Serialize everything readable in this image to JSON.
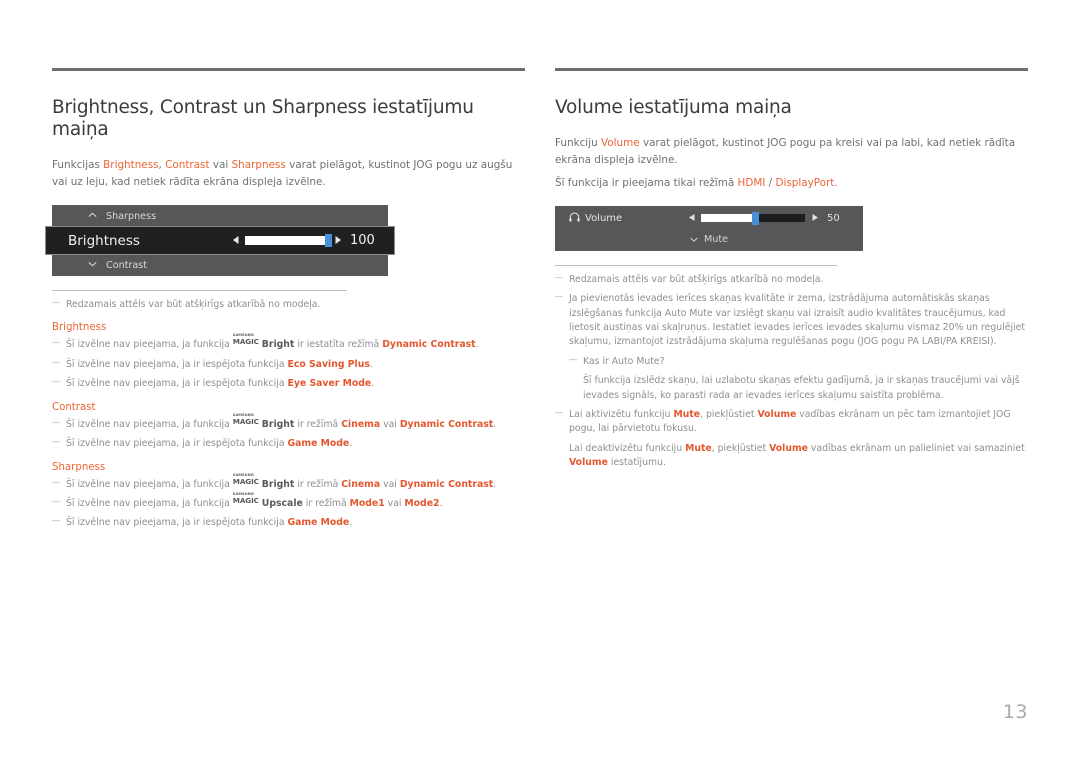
{
  "page": {
    "number": "13",
    "language": "lv"
  },
  "left": {
    "title": "Brightness, Contrast un Sharpness iestatījumu maiņa",
    "intro": {
      "pre": "Funkcijas ",
      "t1": "Brightness",
      "sep1": ", ",
      "t2": "Contrast",
      "sep2": " vai ",
      "t3": "Sharpness",
      "post": " varat pielāgot, kustinot JOG pogu uz augšu vai uz leju, kad netiek rādīta ekrāna displeja izvēlne."
    },
    "osd": {
      "top_label": "Sharpness",
      "top_chevron": "chevron-up-icon",
      "main_label": "Brightness",
      "main_value": "100",
      "slider_percent": 100,
      "bottom_label": "Contrast",
      "bottom_chevron": "chevron-down-icon",
      "arrow_left": "◀",
      "arrow_right": "▶"
    },
    "image_note": "Redzamais attēls var būt atšķirīgs atkarībā no modeļa.",
    "groups": [
      {
        "heading": "Brightness",
        "notes": [
          {
            "pre": "Šī izvēlne nav pieejama, ja funkcija ",
            "magic": true,
            "magic_brand": "SAMSUNG",
            "magic_word": "MAGIC",
            "bold_dark": "Bright",
            "mid": " ir iestatīta režīmā ",
            "hl": "Dynamic Contrast",
            "post": "."
          },
          {
            "pre": "Šī izvēlne nav pieejama, ja ir iespējota funkcija ",
            "magic": false,
            "hl": "Eco Saving Plus",
            "post": "."
          },
          {
            "pre": "Šī izvēlne nav pieejama, ja ir iespējota funkcija ",
            "magic": false,
            "hl": "Eye Saver Mode",
            "post": "."
          }
        ]
      },
      {
        "heading": "Contrast",
        "notes": [
          {
            "pre": "Šī izvēlne nav pieejama, ja funkcija ",
            "magic": true,
            "magic_brand": "SAMSUNG",
            "magic_word": "MAGIC",
            "bold_dark": "Bright",
            "mid": " ir režīmā ",
            "hl": "Cinema",
            "mid2": " vai ",
            "hl2": "Dynamic Contrast",
            "post": "."
          },
          {
            "pre": "Šī izvēlne nav pieejama, ja ir iespējota funkcija ",
            "magic": false,
            "hl": "Game Mode",
            "post": "."
          }
        ]
      },
      {
        "heading": "Sharpness",
        "notes": [
          {
            "pre": "Šī izvēlne nav pieejama, ja funkcija ",
            "magic": true,
            "magic_brand": "SAMSUNG",
            "magic_word": "MAGIC",
            "bold_dark": "Bright",
            "mid": " ir režīmā ",
            "hl": "Cinema",
            "mid2": " vai ",
            "hl2": "Dynamic Contrast",
            "post": "."
          },
          {
            "pre": "Šī izvēlne nav pieejama, ja funkcija ",
            "magic": true,
            "magic_brand": "SAMSUNG",
            "magic_word": "MAGIC",
            "bold_dark": "Upscale",
            "mid": " ir režīmā ",
            "hl": "Mode1",
            "mid2": " vai ",
            "hl2": "Mode2",
            "post": "."
          },
          {
            "pre": "Šī izvēlne nav pieejama, ja ir iespējota funkcija ",
            "magic": false,
            "hl": "Game Mode",
            "post": "."
          }
        ]
      }
    ]
  },
  "right": {
    "title": "Volume iestatījuma maiņa",
    "intro": {
      "pre": "Funkciju ",
      "t1": "Volume",
      "post": " varat pielāgot, kustinot JOG pogu pa kreisi vai pa labi, kad netiek rādīta ekrāna displeja izvēlne."
    },
    "availability": {
      "pre": "Šī funkcija ir pieejama tikai režīmā ",
      "t1": "HDMI",
      "sep": " / ",
      "t2": "DisplayPort",
      "post": "."
    },
    "osd": {
      "icon": "headphone-icon",
      "label": "Volume",
      "value": "50",
      "slider_percent": 52,
      "mute_label": "Mute",
      "mute_chevron": "chevron-down-icon",
      "arrow_left": "◀",
      "arrow_right": "▶"
    },
    "image_note": "Redzamais attēls var būt atšķirīgs atkarībā no modeļa.",
    "note_auto_mute": "Ja pievienotās ievades ierīces skaņas kvalitāte ir zema, izstrādājuma automātiskās skaņas izslēgšanas funkcija Auto Mute var izslēgt skaņu vai izraisīt audio kvalitātes traucējumus, kad lietosit austiņas vai skaļruņus. Iestatiet ievades ierīces ievades skaļumu vismaz 20% un regulējiet skaļumu, izmantojot izstrādājuma skaļuma regulēšanas pogu (JOG pogu PA LABI/PA KREISI).",
    "note_what_is": "Kas ir Auto Mute?",
    "note_what_is_body": "Šī funkcija izslēdz skaņu, lai uzlabotu skaņas efektu gadījumā, ja ir skaņas traucējumi vai vājš ievades signāls, ko parasti rada ar ievades ierīces skaļumu saistīta problēma.",
    "note_activate": {
      "pre": "Lai aktivizētu funkciju ",
      "t1": "Mute",
      "mid": ", piekļūstiet ",
      "t2": "Volume",
      "post": " vadības ekrānam un pēc tam izmantojiet JOG pogu, lai pārvietotu fokusu."
    },
    "note_deactivate": {
      "pre": "Lai deaktivizētu funkciju ",
      "t1": "Mute",
      "mid": ", piekļūstiet ",
      "t2": "Volume",
      "mid2": " vadības ekrānam un palieliniet vai samaziniet ",
      "t3": "Volume",
      "post": " iestatījumu."
    }
  },
  "colors": {
    "accent": "#ec6433",
    "accent_bold": "#e4572e",
    "text": "#6f7072",
    "title": "#3b3b3d",
    "note": "#8d8e90",
    "rule": "#6d6e71",
    "osd_bg": "#565759",
    "osd_highlight": "#1f2021",
    "slider_knob": "#4a90d9",
    "page_num": "#a7a9ac"
  }
}
